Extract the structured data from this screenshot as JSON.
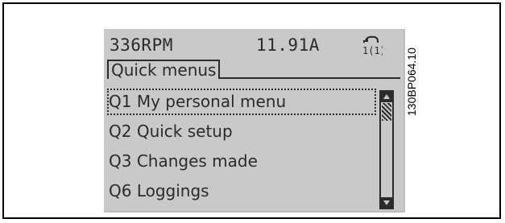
{
  "status": {
    "speed": "336RPM",
    "current": "11.91A",
    "mode_icon": "hand-on-icon",
    "mode_icon_label": "1(1)"
  },
  "title": "Quick menus",
  "menu": {
    "items": [
      {
        "label": "Q1 My personal menu",
        "selected": true
      },
      {
        "label": "Q2 Quick setup",
        "selected": false
      },
      {
        "label": "Q3 Changes made",
        "selected": false
      },
      {
        "label": "Q6 Loggings",
        "selected": false
      }
    ]
  },
  "figure_code": "130BP064.10",
  "colors": {
    "lcd_background": "#c9c9c9",
    "lcd_text": "#2b2b2b"
  }
}
